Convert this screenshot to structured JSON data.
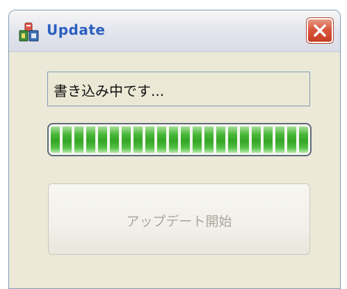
{
  "window": {
    "title": "Update",
    "icons": {
      "app": "update-app-icon",
      "close": "close-x-icon"
    }
  },
  "status": {
    "text": "書き込み中です..."
  },
  "progress": {
    "fraction": 1.0,
    "color": "#35a526"
  },
  "actions": {
    "start_label": "アップデート開始",
    "start_enabled": false
  },
  "colors": {
    "title_text": "#2a5fc0",
    "close_button": "#d8583e",
    "window_bg": "#ece9d8"
  }
}
